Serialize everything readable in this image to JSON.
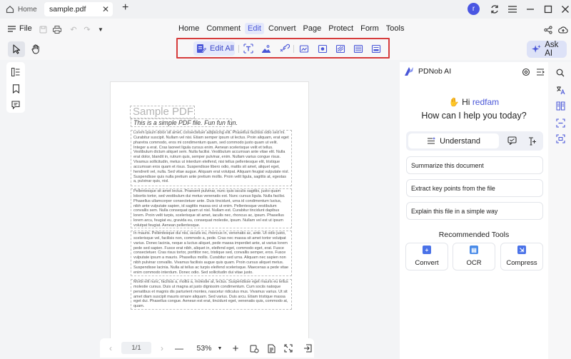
{
  "tabs": {
    "home": "Home",
    "document": "sample.pdf"
  },
  "user": {
    "initial": "r"
  },
  "file_menu": {
    "label": "File"
  },
  "menu": [
    "Home",
    "Comment",
    "Edit",
    "Convert",
    "Page",
    "Protect",
    "Form",
    "Tools"
  ],
  "menu_active": "Edit",
  "toolbar": {
    "edit_all": "Edit All"
  },
  "ask_ai": {
    "label": "Ask AI"
  },
  "document": {
    "title": "Sample PDF",
    "subtitle": "This is a simple PDF file. Fun fun fun.",
    "paragraphs": [
      "Lorem ipsum dolor sit amet, consectetuer adipiscing elit. Phasellus facilisis odio sed mi. Curabitur suscipit. Nullam vel nisi. Etiam semper ipsum ut lectus. Proin aliquam, erat eget pharetra commodo, eros mi condimentum quam, sed commodo justo quam ut velit. Integer a erat. Cras laoreet ligula cursus enim. Aenean scelerisque velit et tellus. Vestibulum dictum aliquet sem. Nulla facilisi. Vestibulum accumsan ante vitae elit. Nulla erat dolor, blandit in, rutrum quis, semper pulvinar, enim. Nullam varius congue risus. Vivamus sollicitudin, metus ut interdum eleifend, nisi tellus pellentesque elit, tristique accumsan eros quam et risus. Suspendisse libero odio, mattis sit amet, aliquet eget, hendrerit vel, nulla. Sed vitae augue. Aliquam erat volutpat. Aliquam feugiat vulputate nisl. Suspendisse quis nulla pretium ante pretium mollis. Proin velit ligula, sagittis at, egestas a, pulvinar quis, nisl.",
      "Pellentesque sit amet lectus. Praesent pulvinar, nunc quis iaculis sagittis, justo quam lobortis tortor, sed vestibulum dui metus venenatis est. Nunc cursus ligula. Nulla facilisi. Phasellus ullamcorper consectetuer ante. Duis tincidunt, urna id condimentum luctus, nibh ante vulputate sapien, id sagittis massa orci ut enim. Pellentesque vestibulum convallis sem. Nulla consequat quam ut nisl. Nullam est. Curabitur tincidunt dapibus lorem. Proin velit turpis, scelerisque sit amet, iaculis nec, rhoncus ac, ipsum. Phasellus lorem arcu, feugiat eu, gravida eu, consequat molestie, ipsum. Nullam vel est ut ipsum volutpat feugiat. Aenean pellentesque.",
      "In mauris. Pellentesque dui nisi, iaculis eu, rhoncus in, venenatis ac, ante. Ut odio justo, scelerisque vel, facilisis non, commodo a, pede. Cras nec massa sit amet tortor volutpat varius. Donec lacinia, neque a luctus aliquet, pede massa imperdiet ante, at varius lorem pede sed sapien. Fusce erat nibh, aliquet in, eleifend eget, commodo eget, erat. Fusce consectetuer. Cras risus tortor, porttitor nec, tristique sed, convallis semper, eros. Fusce vulputate ipsum a mauris. Phasellus mollis. Curabitur sed urna. Aliquam nec sapien non nibh pulvinar convallis. Vivamus facilisis augue quis quam. Proin cursus aliquet metus. Suspendisse lacinia. Nulla at tellus ac turpis eleifend scelerisque. Maecenas a pede vitae enim commodo interdum. Donec odio. Sed sollicitudin dui vitae justo.",
      "Morbi elit nunc, facilisis a, mollis a, molestie at, lectus. Suspendisse eget mauris eu tellus molestie cursus. Duis ut magna at justo dignissim condimentum. Cum sociis natoque penatibus et magnis dis parturient montes, nascetur ridiculus mus. Vivamus varius. Ut sit amet diam suscipit mauris ornare aliquam. Sed varius. Duis arcu. Etiam tristique massa eget dui. Phasellus congue. Aenean est erat, tincidunt eget, venenatis quis, commodo at, quam."
    ]
  },
  "pagination": {
    "current": "1/1",
    "zoom": "53%"
  },
  "ai_panel": {
    "title": "PDNob AI",
    "greeting": "Hi",
    "username": "redfam",
    "question": "How can I help you today?",
    "tab_active": "Understand",
    "suggestions": [
      "Summarize this document",
      "Extract key points from the file",
      "Explain this file in a simple way"
    ],
    "recommended_title": "Recommended Tools",
    "tools": [
      {
        "label": "Convert",
        "color": "#4a72e8"
      },
      {
        "label": "OCR",
        "color": "#4a8be8"
      },
      {
        "label": "Compress",
        "color": "#4a72e8"
      }
    ]
  },
  "colors": {
    "accent": "#4a57d8",
    "highlight_box": "#d63b3b"
  }
}
